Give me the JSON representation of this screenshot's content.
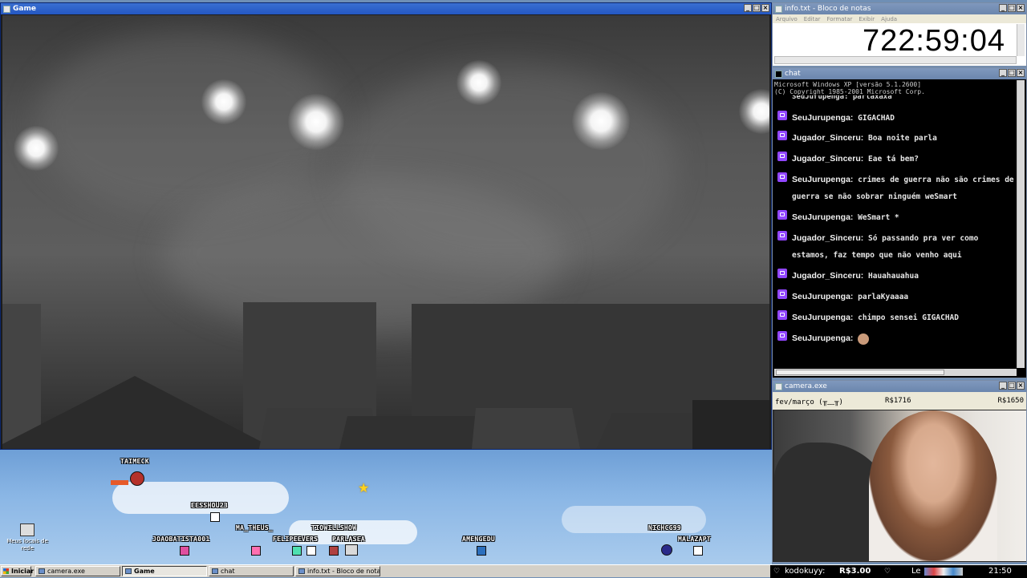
{
  "game_window": {
    "title": "Game"
  },
  "overlay": {
    "desktop_icon": {
      "label": "Meus locais de rede"
    },
    "viewers": [
      "TAIMECK",
      "EESSHOU23",
      "JOAOBATISTA001",
      "MA_THEUS_",
      "FELIPEEVERS",
      "TIOWILLSHOW",
      "PARLASEA",
      "AMENGEDU",
      "NICHCG99",
      "MALAZAPT"
    ]
  },
  "notepad": {
    "title": "info.txt - Bloco de notas",
    "menu": [
      "Arquivo",
      "Editar",
      "Formatar",
      "Exibir",
      "Ajuda"
    ],
    "timer": "722:59:04"
  },
  "chat": {
    "title": "chat",
    "header_lines": [
      "Microsoft Windows XP [versão 5.1.2600]",
      "(C) Copyright 1985-2001 Microsoft Corp."
    ],
    "partial_top": "SeuJurupenga: parlaxaxa",
    "messages": [
      {
        "user": "SeuJurupenga:",
        "text": "GIGACHAD"
      },
      {
        "user": "Jugador_Sinceru:",
        "text": "Boa noite parla"
      },
      {
        "user": "Jugador_Sinceru:",
        "text": "Eae tá bem?"
      },
      {
        "user": "SeuJurupenga:",
        "text": "crimes de guerra não são crimes de guerra se não sobrar ninguém weSmart"
      },
      {
        "user": "SeuJurupenga:",
        "text": "WeSmart *"
      },
      {
        "user": "Jugador_Sinceru:",
        "text": "Só passando pra ver como estamos, faz tempo que não venho aqui"
      },
      {
        "user": "Jugador_Sinceru:",
        "text": "Hauahauahua"
      },
      {
        "user": "SeuJurupenga:",
        "text": "parlaKyaaaa"
      },
      {
        "user": "SeuJurupenga:",
        "text": "chimpo sensei GIGACHAD"
      },
      {
        "user": "SeuJurupenga:",
        "text": ""
      }
    ]
  },
  "camera": {
    "title": "camera.exe",
    "label_period": "fev/março (╥﹏╥)",
    "amount_1": "R$1716",
    "amount_2": "R$1650"
  },
  "taskbar": {
    "start": "Iniciar",
    "tasks": [
      "camera.exe",
      "Game",
      "chat",
      "info.txt - Bloco de notas"
    ],
    "ticker_user": "kodokuyy:",
    "ticker_amount": "R$3.00",
    "ticker_next": "Le",
    "clock": "21:50"
  },
  "colors": {
    "twitch": "#9146ff",
    "title_active": "#2457c2",
    "console_bg": "#000000"
  }
}
